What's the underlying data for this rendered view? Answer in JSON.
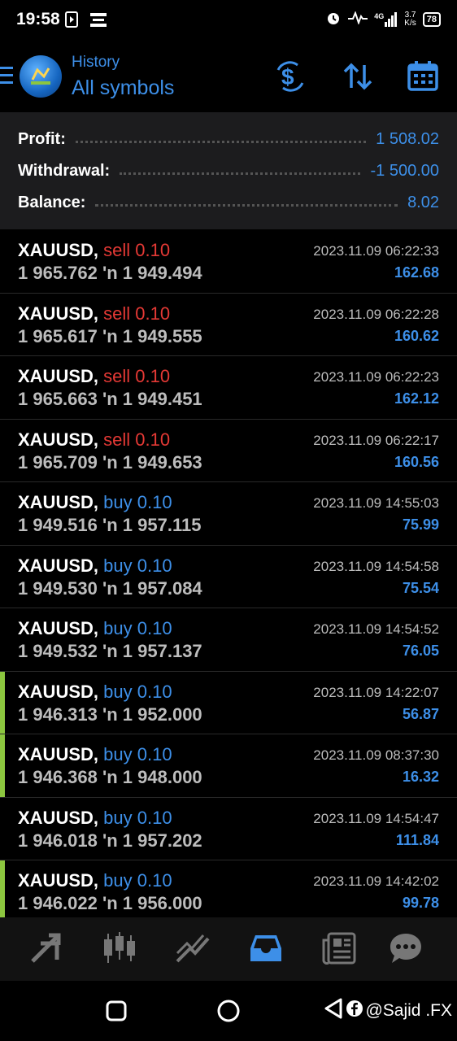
{
  "status_bar": {
    "time": "19:58",
    "network": "4G",
    "net_speed_value": "3.7",
    "net_speed_unit": "K/s",
    "battery": "78"
  },
  "toolbar": {
    "title": "History",
    "subtitle": "All symbols"
  },
  "summary": {
    "profit_label": "Profit:",
    "profit_value": "1 508.02",
    "withdrawal_label": "Withdrawal:",
    "withdrawal_value": "-1 500.00",
    "balance_label": "Balance:",
    "balance_value": "8.02"
  },
  "deals": [
    {
      "symbol": "XAUUSD,",
      "side": "sell",
      "volume": "0.10",
      "open": "1 965.762",
      "close": "1 949.494",
      "time": "2023.11.09 06:22:33",
      "profit": "162.68",
      "marked": false
    },
    {
      "symbol": "XAUUSD,",
      "side": "sell",
      "volume": "0.10",
      "open": "1 965.617",
      "close": "1 949.555",
      "time": "2023.11.09 06:22:28",
      "profit": "160.62",
      "marked": false
    },
    {
      "symbol": "XAUUSD,",
      "side": "sell",
      "volume": "0.10",
      "open": "1 965.663",
      "close": "1 949.451",
      "time": "2023.11.09 06:22:23",
      "profit": "162.12",
      "marked": false
    },
    {
      "symbol": "XAUUSD,",
      "side": "sell",
      "volume": "0.10",
      "open": "1 965.709",
      "close": "1 949.653",
      "time": "2023.11.09 06:22:17",
      "profit": "160.56",
      "marked": false
    },
    {
      "symbol": "XAUUSD,",
      "side": "buy",
      "volume": "0.10",
      "open": "1 949.516",
      "close": "1 957.115",
      "time": "2023.11.09 14:55:03",
      "profit": "75.99",
      "marked": false
    },
    {
      "symbol": "XAUUSD,",
      "side": "buy",
      "volume": "0.10",
      "open": "1 949.530",
      "close": "1 957.084",
      "time": "2023.11.09 14:54:58",
      "profit": "75.54",
      "marked": false
    },
    {
      "symbol": "XAUUSD,",
      "side": "buy",
      "volume": "0.10",
      "open": "1 949.532",
      "close": "1 957.137",
      "time": "2023.11.09 14:54:52",
      "profit": "76.05",
      "marked": false
    },
    {
      "symbol": "XAUUSD,",
      "side": "buy",
      "volume": "0.10",
      "open": "1 946.313",
      "close": "1 952.000",
      "time": "2023.11.09 14:22:07",
      "profit": "56.87",
      "marked": true
    },
    {
      "symbol": "XAUUSD,",
      "side": "buy",
      "volume": "0.10",
      "open": "1 946.368",
      "close": "1 948.000",
      "time": "2023.11.09 08:37:30",
      "profit": "16.32",
      "marked": true
    },
    {
      "symbol": "XAUUSD,",
      "side": "buy",
      "volume": "0.10",
      "open": "1 946.018",
      "close": "1 957.202",
      "time": "2023.11.09 14:54:47",
      "profit": "111.84",
      "marked": false
    },
    {
      "symbol": "XAUUSD,",
      "side": "buy",
      "volume": "0.10",
      "open": "1 946.022",
      "close": "1 956.000",
      "time": "2023.11.09 14:42:02",
      "profit": "99.78",
      "marked": true
    }
  ],
  "price_arrow": "'n",
  "bottom_nav": [
    "quotes-icon",
    "chart-icon",
    "trade-icon",
    "history-icon",
    "news-icon",
    "chat-icon"
  ],
  "watermark": "@Sajid .FX",
  "colors": {
    "accent": "#3d8fe8",
    "sell": "#e53935",
    "buy": "#3d8fe8",
    "marker": "#8cc63f"
  }
}
